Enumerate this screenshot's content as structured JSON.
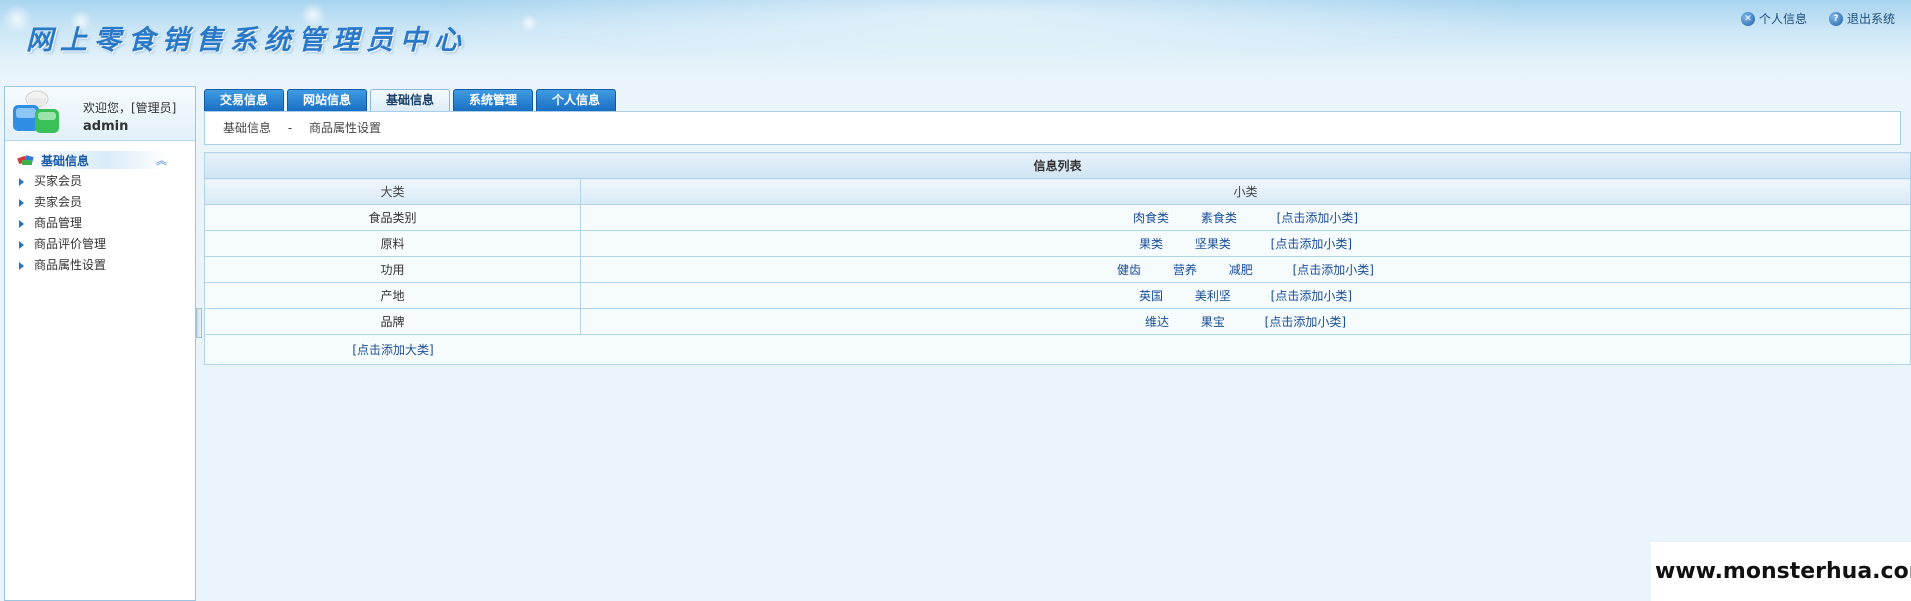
{
  "header": {
    "title": "网上零食销售系统管理员中心",
    "links": [
      {
        "label": "个人信息",
        "icon": "close-circle-icon"
      },
      {
        "label": "退出系统",
        "icon": "help-circle-icon"
      }
    ]
  },
  "user": {
    "welcome": "欢迎您，[管理员]",
    "name": "admin"
  },
  "sidebar": {
    "section_title": "基础信息",
    "items": [
      {
        "label": "买家会员"
      },
      {
        "label": "卖家会员"
      },
      {
        "label": "商品管理"
      },
      {
        "label": "商品评价管理"
      },
      {
        "label": "商品属性设置"
      }
    ]
  },
  "tabs": [
    {
      "label": "交易信息",
      "active": false
    },
    {
      "label": "网站信息",
      "active": false
    },
    {
      "label": "基础信息",
      "active": true
    },
    {
      "label": "系统管理",
      "active": false
    },
    {
      "label": "个人信息",
      "active": false
    }
  ],
  "breadcrumb": {
    "parent": "基础信息",
    "separator": "-",
    "current": "商品属性设置"
  },
  "table": {
    "caption": "信息列表",
    "columns": [
      "大类",
      "小类"
    ],
    "rows": [
      {
        "category": "食品类别",
        "subs": [
          "肉食类",
          "素食类"
        ]
      },
      {
        "category": "原料",
        "subs": [
          "果类",
          "坚果类"
        ]
      },
      {
        "category": "功用",
        "subs": [
          "健齿",
          "营养",
          "减肥"
        ]
      },
      {
        "category": "产地",
        "subs": [
          "英国",
          "美利坚"
        ]
      },
      {
        "category": "品牌",
        "subs": [
          "维达",
          "果宝"
        ]
      }
    ],
    "add_sub_label": "[点击添加小类]",
    "add_category_label": "[点击添加大类]"
  },
  "watermark": "www.monsterhua.com"
}
